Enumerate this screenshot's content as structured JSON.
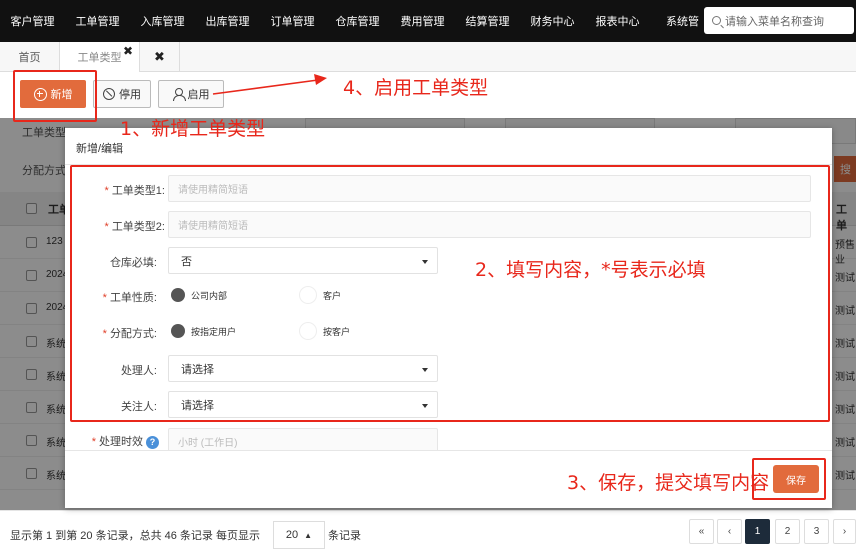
{
  "topnav": {
    "items": [
      "客户管理",
      "工单管理",
      "入库管理",
      "出库管理",
      "订单管理",
      "仓库管理",
      "费用管理",
      "结算管理",
      "财务中心",
      "报表中心",
      "系统管"
    ],
    "search_placeholder": "请输入菜单名称查询"
  },
  "tabs": {
    "home": "首页",
    "current": "工单类型",
    "close_glyph": "✖"
  },
  "toolbar": {
    "add": "新增",
    "disable": "停用",
    "enable": "启用"
  },
  "background": {
    "filter_label_1": "工单类型",
    "filter_label_2": "分配方式",
    "search_btn": "搜",
    "header_col1": "工单",
    "header_col2": "工单",
    "rows": [
      {
        "c1": "123",
        "c2": "预售业"
      },
      {
        "c1": "2024",
        "c2": "测试"
      },
      {
        "c1": "2024",
        "c2": "测试"
      },
      {
        "c1": "系统",
        "c2": "测试"
      },
      {
        "c1": "系统",
        "c2": "测试"
      },
      {
        "c1": "系统",
        "c2": "测试"
      },
      {
        "c1": "系统",
        "c2": "测试"
      },
      {
        "c1": "系统",
        "c2": "测试"
      }
    ]
  },
  "modal": {
    "title": "新增/编辑",
    "fields": {
      "type1_label": "工单类型1:",
      "type1_placeholder": "请使用精简短语",
      "type2_label": "工单类型2:",
      "type2_placeholder": "请使用精简短语",
      "warehouse_label": "仓库必填:",
      "warehouse_value": "否",
      "nature_label": "工单性质:",
      "nature_option1": "公司内部",
      "nature_option2": "客户",
      "assign_label": "分配方式:",
      "assign_option1": "按指定用户",
      "assign_option2": "按客户",
      "handler_label": "处理人:",
      "handler_value": "请选择",
      "follower_label": "关注人:",
      "follower_value": "请选择",
      "timeliness_label": "处理时效",
      "timeliness_placeholder": "小时 (工作日)"
    },
    "required_mark": "*",
    "help_glyph": "?",
    "save": "保存"
  },
  "footer": {
    "info": "显示第 1 到第 20 条记录，总共 46 条记录 每页显示",
    "page_size": "20",
    "page_size_arrow": "▲",
    "info_suffix": "条记录",
    "pages": [
      "«",
      "‹",
      "1",
      "2",
      "3",
      "›"
    ],
    "active_page": "1"
  },
  "annotations": {
    "step1": "1、新增工单类型",
    "step2": "2、填写内容，*号表示必填",
    "step3": "3、保存，提交填写内容",
    "step4": "4、启用工单类型",
    "color": "#e8271b"
  }
}
